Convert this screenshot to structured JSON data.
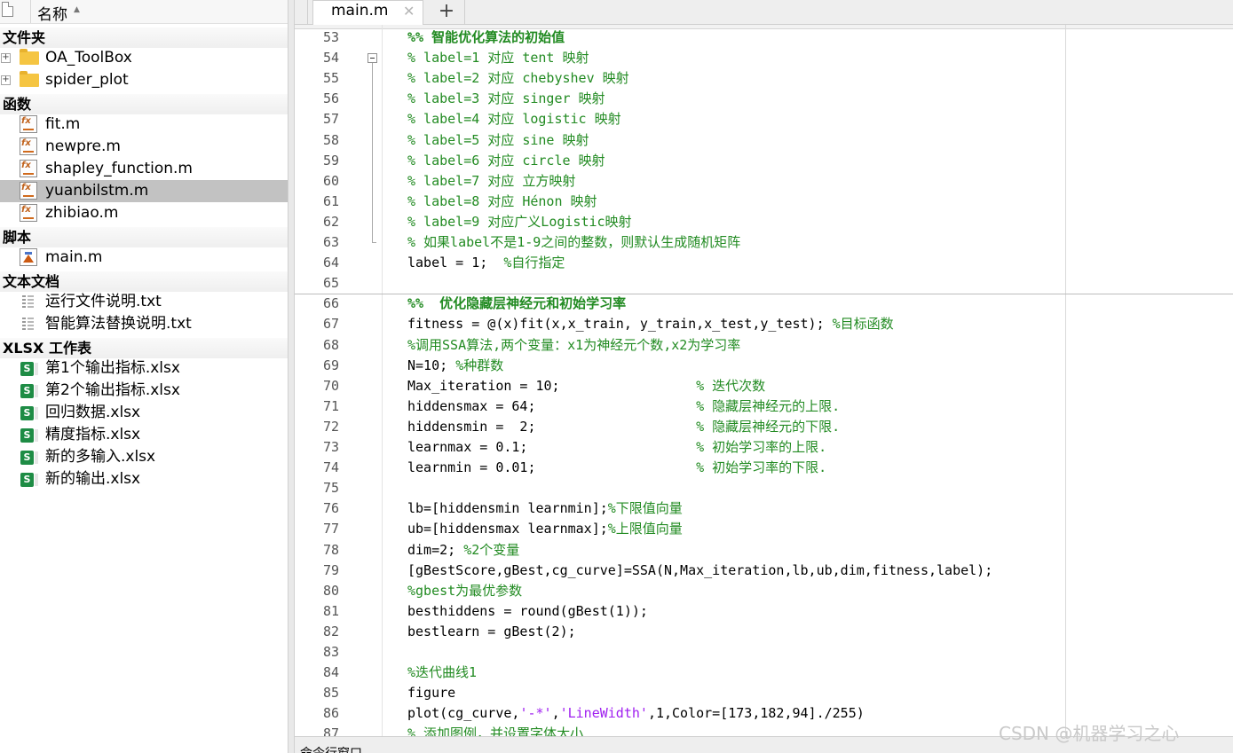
{
  "browser": {
    "header_label": "名称",
    "groups": {
      "folders": "文件夹",
      "functions": "函数",
      "scripts": "脚本",
      "text_docs": "文本文档",
      "xlsx": "XLSX 工作表"
    },
    "folders": [
      "OA_ToolBox",
      "spider_plot"
    ],
    "functions": [
      "fit.m",
      "newpre.m",
      "shapley_function.m",
      "yuanbilstm.m",
      "zhibiao.m"
    ],
    "selected_function": "yuanbilstm.m",
    "scripts": [
      "main.m"
    ],
    "text_docs": [
      "运行文件说明.txt",
      "智能算法替换说明.txt"
    ],
    "xlsx_files": [
      "第1个输出指标.xlsx",
      "第2个输出指标.xlsx",
      "回归数据.xlsx",
      "精度指标.xlsx",
      "新的多输入.xlsx",
      "新的输出.xlsx"
    ]
  },
  "editor": {
    "tab_label": "main.m",
    "tab_close": "✕",
    "add_tab": "+",
    "lines": [
      {
        "n": "53",
        "segs": [
          {
            "t": "%% 智能优化算法的初始值",
            "c": "cmb"
          }
        ]
      },
      {
        "n": "54",
        "segs": [
          {
            "t": "% label=1 对应 tent 映射",
            "c": "cm"
          }
        ]
      },
      {
        "n": "55",
        "segs": [
          {
            "t": "% label=2 对应 chebyshev 映射",
            "c": "cm"
          }
        ]
      },
      {
        "n": "56",
        "segs": [
          {
            "t": "% label=3 对应 singer 映射",
            "c": "cm"
          }
        ]
      },
      {
        "n": "57",
        "segs": [
          {
            "t": "% label=4 对应 logistic 映射",
            "c": "cm"
          }
        ]
      },
      {
        "n": "58",
        "segs": [
          {
            "t": "% label=5 对应 sine 映射",
            "c": "cm"
          }
        ]
      },
      {
        "n": "59",
        "segs": [
          {
            "t": "% label=6 对应 circle 映射",
            "c": "cm"
          }
        ]
      },
      {
        "n": "60",
        "segs": [
          {
            "t": "% label=7 对应 立方映射",
            "c": "cm"
          }
        ]
      },
      {
        "n": "61",
        "segs": [
          {
            "t": "% label=8 对应 Hénon 映射",
            "c": "cm"
          }
        ]
      },
      {
        "n": "62",
        "segs": [
          {
            "t": "% label=9 对应广义Logistic映射",
            "c": "cm"
          }
        ]
      },
      {
        "n": "63",
        "segs": [
          {
            "t": "% 如果label不是1-9之间的整数，则默认生成随机矩阵",
            "c": "cm"
          }
        ]
      },
      {
        "n": "64",
        "segs": [
          {
            "t": "label = 1;  ",
            "c": ""
          },
          {
            "t": "%自行指定",
            "c": "cm"
          }
        ]
      },
      {
        "n": "65",
        "segs": []
      },
      {
        "n": "66",
        "segs": [
          {
            "t": "%%  优化隐藏层神经元和初始学习率",
            "c": "cmb"
          }
        ]
      },
      {
        "n": "67",
        "segs": [
          {
            "t": "fitness = @(x)fit(x,x_train, y_train,x_test,y_test); ",
            "c": ""
          },
          {
            "t": "%目标函数",
            "c": "cm"
          }
        ]
      },
      {
        "n": "68",
        "segs": [
          {
            "t": "%调用SSA算法,两个变量：x1为神经元个数,x2为学习率",
            "c": "cm"
          }
        ]
      },
      {
        "n": "69",
        "segs": [
          {
            "t": "N=10; ",
            "c": ""
          },
          {
            "t": "%种群数",
            "c": "cm"
          }
        ]
      },
      {
        "n": "70",
        "segs": [
          {
            "t": "Max_iteration = 10;                 ",
            "c": ""
          },
          {
            "t": "% 迭代次数",
            "c": "cm"
          }
        ]
      },
      {
        "n": "71",
        "segs": [
          {
            "t": "hiddensmax = 64;                    ",
            "c": ""
          },
          {
            "t": "% 隐藏层神经元的上限.",
            "c": "cm"
          }
        ]
      },
      {
        "n": "72",
        "segs": [
          {
            "t": "hiddensmin =  2;                    ",
            "c": ""
          },
          {
            "t": "% 隐藏层神经元的下限.",
            "c": "cm"
          }
        ]
      },
      {
        "n": "73",
        "segs": [
          {
            "t": "learnmax = 0.1;                     ",
            "c": ""
          },
          {
            "t": "% 初始学习率的上限.",
            "c": "cm"
          }
        ]
      },
      {
        "n": "74",
        "segs": [
          {
            "t": "learnmin = 0.01;                    ",
            "c": ""
          },
          {
            "t": "% 初始学习率的下限.",
            "c": "cm"
          }
        ]
      },
      {
        "n": "75",
        "segs": []
      },
      {
        "n": "76",
        "segs": [
          {
            "t": "lb=[hiddensmin learnmin];",
            "c": ""
          },
          {
            "t": "%下限值向量",
            "c": "cm"
          }
        ]
      },
      {
        "n": "77",
        "segs": [
          {
            "t": "ub=[hiddensmax learnmax];",
            "c": ""
          },
          {
            "t": "%上限值向量",
            "c": "cm"
          }
        ]
      },
      {
        "n": "78",
        "segs": [
          {
            "t": "dim=2; ",
            "c": ""
          },
          {
            "t": "%2个变量",
            "c": "cm"
          }
        ]
      },
      {
        "n": "79",
        "segs": [
          {
            "t": "[gBestScore,gBest,cg_curve]=SSA(N,Max_iteration,lb,ub,dim,fitness,label);",
            "c": ""
          }
        ]
      },
      {
        "n": "80",
        "segs": [
          {
            "t": "%gbest为最优参数",
            "c": "cm"
          }
        ]
      },
      {
        "n": "81",
        "segs": [
          {
            "t": "besthiddens = round(gBest(1));",
            "c": ""
          }
        ]
      },
      {
        "n": "82",
        "segs": [
          {
            "t": "bestlearn = gBest(2);",
            "c": ""
          }
        ]
      },
      {
        "n": "83",
        "segs": []
      },
      {
        "n": "84",
        "segs": [
          {
            "t": "%迭代曲线1",
            "c": "cm"
          }
        ]
      },
      {
        "n": "85",
        "segs": [
          {
            "t": "figure",
            "c": ""
          }
        ]
      },
      {
        "n": "86",
        "segs": [
          {
            "t": "plot(cg_curve,",
            "c": ""
          },
          {
            "t": "'-*'",
            "c": "st"
          },
          {
            "t": ",",
            "c": ""
          },
          {
            "t": "'LineWidth'",
            "c": "st"
          },
          {
            "t": ",1,Color=[173,182,94]./255)",
            "c": ""
          }
        ]
      },
      {
        "n": "87",
        "segs": [
          {
            "t": "% 添加图例，并设置字体大小",
            "c": "cm"
          }
        ]
      }
    ]
  },
  "command_window": {
    "label": "命令行窗口"
  },
  "watermark": "CSDN @机器学习之心"
}
